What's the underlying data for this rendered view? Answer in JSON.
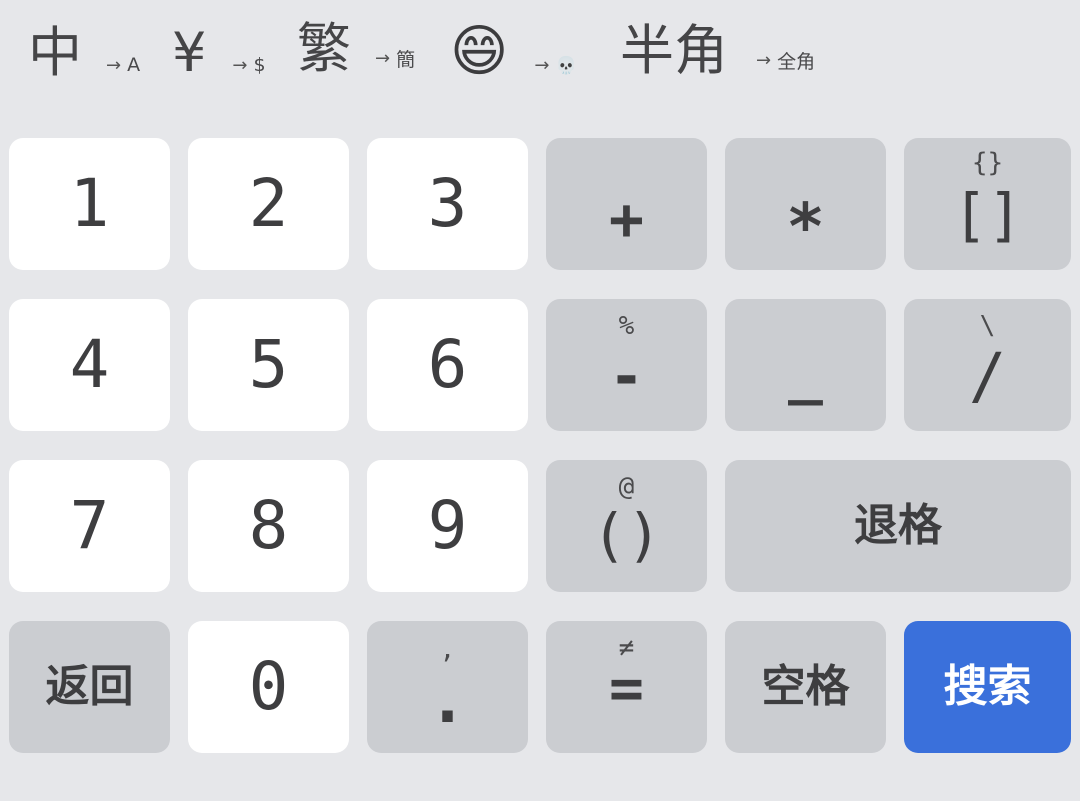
{
  "toolbar": {
    "items": [
      {
        "main": "中",
        "sub": "A"
      },
      {
        "main": "¥",
        "sub": "$"
      },
      {
        "main": "繁",
        "sub": "簡"
      },
      {
        "main": "😄",
        "sub": "💀"
      },
      {
        "main": "半角",
        "sub": "全角"
      }
    ],
    "arrow": "→"
  },
  "keys": {
    "k1": "1",
    "k2": "2",
    "k3": "3",
    "k4": "4",
    "k5": "5",
    "k6": "6",
    "k7": "7",
    "k8": "8",
    "k9": "9",
    "k0": "0",
    "plus": "+",
    "asterisk": "*",
    "brackets": {
      "main": "[]",
      "alt": "{}"
    },
    "minus": {
      "main": "-",
      "alt": "%"
    },
    "underscore": "_",
    "slash": {
      "main": "/",
      "alt": "\\"
    },
    "parens": {
      "main": "()",
      "alt": "@"
    },
    "backspace": "退格",
    "back": "返回",
    "period": {
      "main": ".",
      "alt": ","
    },
    "equals": {
      "main": "=",
      "alt": "≠"
    },
    "space": "空格",
    "search": "搜索"
  },
  "colors": {
    "background": "#e6e7ea",
    "key_white": "#ffffff",
    "key_gray": "#cbcdd1",
    "accent": "#3a70db"
  }
}
